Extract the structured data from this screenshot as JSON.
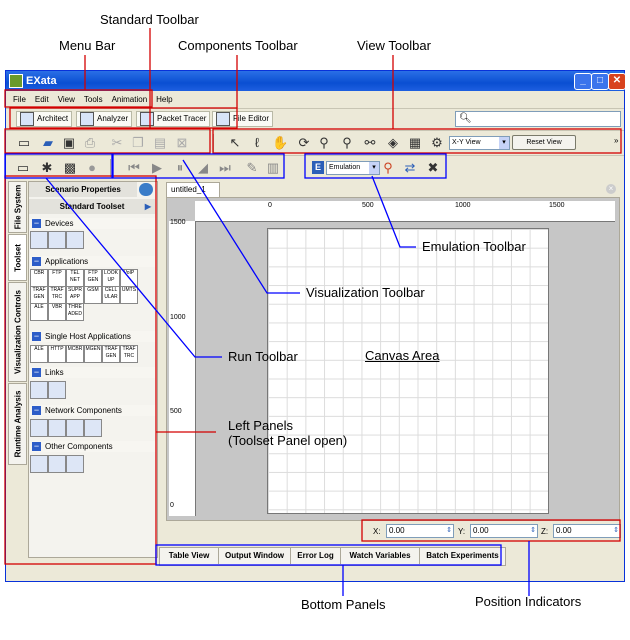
{
  "callouts": {
    "standard_toolbar": "Standard Toolbar",
    "menu_bar": "Menu Bar",
    "components_toolbar": "Components Toolbar",
    "view_toolbar": "View Toolbar",
    "emulation_toolbar": "Emulation Toolbar",
    "visualization_toolbar": "Visualization Toolbar",
    "run_toolbar": "Run Toolbar",
    "canvas_area": "Canvas Area",
    "left_panels_1": "Left Panels",
    "left_panels_2": "(Toolset Panel open)",
    "bottom_panels": "Bottom Panels",
    "position_indicators": "Position Indicators"
  },
  "window": {
    "title": "EXata",
    "menu": [
      "File",
      "Edit",
      "View",
      "Tools",
      "Animation",
      "Help"
    ]
  },
  "components": [
    "Architect",
    "Analyzer",
    "Packet Tracer",
    "File Editor"
  ],
  "view_toolbar": {
    "view_select": "X-Y View",
    "reset_button": "Reset View"
  },
  "emulation_toolbar": {
    "select": "Emulation"
  },
  "canvas": {
    "tab": "untitled_1",
    "h_ticks": [
      "0",
      "500",
      "1000",
      "1500"
    ],
    "v_ticks": [
      "1500",
      "1000",
      "500",
      "0"
    ]
  },
  "left_panel": {
    "tabs": [
      "File System",
      "Toolset",
      "Visualization Controls",
      "Runtime Analysis"
    ],
    "scenario_properties": "Scenario Properties",
    "standard_toolset": "Standard Toolset",
    "sections": [
      {
        "label": "Devices",
        "items": [
          "",
          "",
          ""
        ]
      },
      {
        "label": "Applications",
        "items": [
          "CBR",
          "FTP",
          "TEL NET",
          "FTP GEN",
          "LOOK UP",
          "VoIP",
          "TRAF GEN",
          "TRAF TRC",
          "SUPR APP",
          "GSM",
          "CELL ULAR",
          "UMTS",
          "ALE",
          "VBR",
          "THRE ADED"
        ]
      },
      {
        "label": "Single Host Applications",
        "items": [
          "ALE",
          "HTTP",
          "MCBR",
          "MGEN",
          "TRAF GEN",
          "TRAF TRC"
        ]
      },
      {
        "label": "Links",
        "items": [
          "",
          ""
        ]
      },
      {
        "label": "Network Components",
        "items": [
          "",
          "",
          "",
          ""
        ]
      },
      {
        "label": "Other Components",
        "items": [
          "",
          "",
          ""
        ]
      }
    ]
  },
  "bottom_tabs": [
    "Table View",
    "Output Window",
    "Error Log",
    "Watch Variables",
    "Batch Experiments"
  ],
  "position": {
    "x_label": "X:",
    "x": "0.00",
    "y_label": "Y:",
    "y": "0.00",
    "z_label": "Z:",
    "z": "0.00"
  },
  "colors": {
    "callout_line": "#0000ff",
    "highlight_box": "#d40000",
    "title_bar": "#0a4fd2"
  }
}
